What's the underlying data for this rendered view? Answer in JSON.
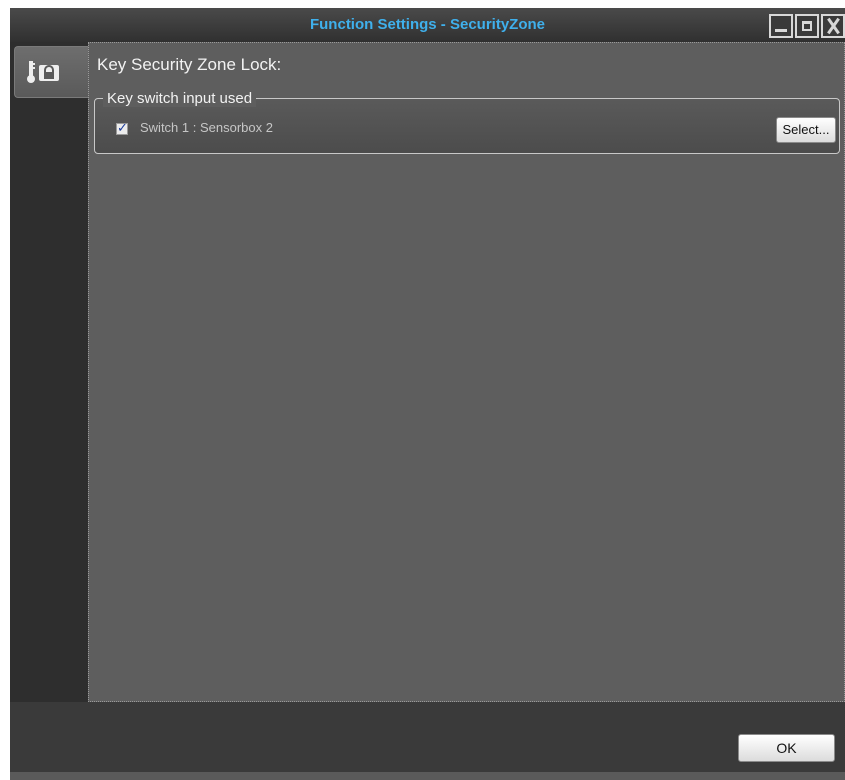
{
  "window": {
    "title": "Function Settings - SecurityZone",
    "title_color": "#3fb0ec",
    "buttons": [
      "minimize-icon",
      "maximize-icon",
      "close-icon"
    ]
  },
  "sidebar": {
    "items": [
      {
        "icon": "key-lock-icon",
        "selected": true
      }
    ]
  },
  "main": {
    "heading": "Key Security Zone Lock:",
    "group": {
      "legend": "Key switch input used",
      "switch": {
        "checked": true,
        "label": "Switch 1 : Sensorbox 2"
      },
      "select_label": "Select..."
    }
  },
  "footer": {
    "ok_label": "OK"
  }
}
